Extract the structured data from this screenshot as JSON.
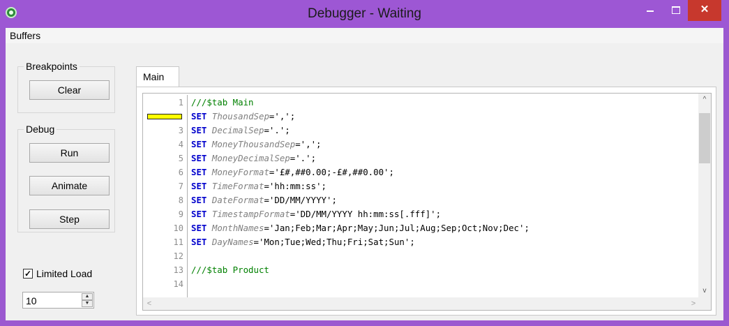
{
  "window": {
    "title": "Debugger - Waiting",
    "minimize_icon": "minimize-icon",
    "maximize_icon": "maximize-icon",
    "close_glyph": "✕"
  },
  "menu": {
    "buffers": "Buffers"
  },
  "breakpoints": {
    "label": "Breakpoints",
    "clear": "Clear"
  },
  "debug": {
    "label": "Debug",
    "run": "Run",
    "animate": "Animate",
    "step": "Step"
  },
  "limited_load": {
    "checked": true,
    "check_glyph": "✓",
    "label": "Limited Load",
    "value": "10"
  },
  "tabs": [
    {
      "label": "Main",
      "active": true
    }
  ],
  "editor": {
    "breakpoint_line": 2,
    "line_numbers": [
      "1",
      "2",
      "3",
      "4",
      "5",
      "6",
      "7",
      "8",
      "9",
      "10",
      "11",
      "12",
      "13",
      "14"
    ],
    "lines": [
      [
        {
          "t": "///$tab Main",
          "c": "cmt"
        }
      ],
      [
        {
          "t": "SET",
          "c": "kw"
        },
        {
          "t": " "
        },
        {
          "t": "ThousandSep",
          "c": "var"
        },
        {
          "t": "=',';"
        }
      ],
      [
        {
          "t": "SET",
          "c": "kw"
        },
        {
          "t": " "
        },
        {
          "t": "DecimalSep",
          "c": "var"
        },
        {
          "t": "='.';"
        }
      ],
      [
        {
          "t": "SET",
          "c": "kw"
        },
        {
          "t": " "
        },
        {
          "t": "MoneyThousandSep",
          "c": "var"
        },
        {
          "t": "=',';"
        }
      ],
      [
        {
          "t": "SET",
          "c": "kw"
        },
        {
          "t": " "
        },
        {
          "t": "MoneyDecimalSep",
          "c": "var"
        },
        {
          "t": "='.';"
        }
      ],
      [
        {
          "t": "SET",
          "c": "kw"
        },
        {
          "t": " "
        },
        {
          "t": "MoneyFormat",
          "c": "var"
        },
        {
          "t": "='£#,##0.00;-£#,##0.00';"
        }
      ],
      [
        {
          "t": "SET",
          "c": "kw"
        },
        {
          "t": " "
        },
        {
          "t": "TimeFormat",
          "c": "var"
        },
        {
          "t": "='hh:mm:ss';"
        }
      ],
      [
        {
          "t": "SET",
          "c": "kw"
        },
        {
          "t": " "
        },
        {
          "t": "DateFormat",
          "c": "var"
        },
        {
          "t": "='DD/MM/YYYY';"
        }
      ],
      [
        {
          "t": "SET",
          "c": "kw"
        },
        {
          "t": " "
        },
        {
          "t": "TimestampFormat",
          "c": "var"
        },
        {
          "t": "='DD/MM/YYYY hh:mm:ss[.fff]';"
        }
      ],
      [
        {
          "t": "SET",
          "c": "kw"
        },
        {
          "t": " "
        },
        {
          "t": "MonthNames",
          "c": "var"
        },
        {
          "t": "='Jan;Feb;Mar;Apr;May;Jun;Jul;Aug;Sep;Oct;Nov;Dec';"
        }
      ],
      [
        {
          "t": "SET",
          "c": "kw"
        },
        {
          "t": " "
        },
        {
          "t": "DayNames",
          "c": "var"
        },
        {
          "t": "='Mon;Tue;Wed;Thu;Fri;Sat;Sun';"
        }
      ],
      [],
      [
        {
          "t": "///$tab Product",
          "c": "cmt"
        }
      ],
      []
    ]
  },
  "scroll_glyphs": {
    "up": "^",
    "down": "v",
    "left": "<",
    "right": ">"
  },
  "spin_glyphs": {
    "up": "▲",
    "down": "▼"
  },
  "colors": {
    "title_bar": "#9d57d4",
    "close_button": "#c7382d",
    "keyword": "#0000cc",
    "variable": "#808080",
    "comment": "#008000",
    "breakpoint_marker": "#ffff00"
  }
}
